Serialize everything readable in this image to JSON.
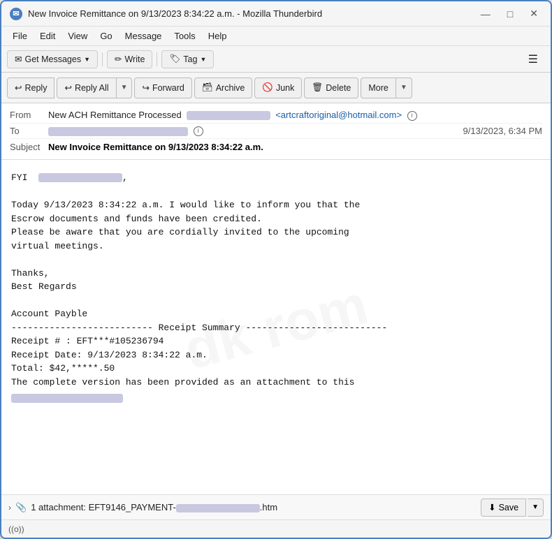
{
  "window": {
    "title": "New Invoice Remittance on 9/13/2023 8:34:22 a.m. - Mozilla Thunderbird",
    "icon": "T"
  },
  "titlebar": {
    "minimize": "—",
    "maximize": "□",
    "close": "✕"
  },
  "menubar": {
    "items": [
      "File",
      "Edit",
      "View",
      "Go",
      "Message",
      "Tools",
      "Help"
    ]
  },
  "toolbar": {
    "get_messages": "Get Messages",
    "write": "Write",
    "tag": "Tag",
    "hamburger": "☰"
  },
  "actionbar": {
    "reply": "Reply",
    "reply_all": "Reply All",
    "forward": "Forward",
    "archive": "Archive",
    "junk": "Junk",
    "delete": "Delete",
    "more": "More"
  },
  "email": {
    "from_label": "From",
    "from_name": "New ACH Remittance Processed",
    "from_email": "<artcraftoriginal@hotmail.com>",
    "to_label": "To",
    "date": "9/13/2023, 6:34 PM",
    "subject_label": "Subject",
    "subject": "New Invoice Remittance on 9/13/2023 8:34:22 a.m.",
    "body_greeting": "FYI",
    "body_lines": [
      "",
      "Today 9/13/2023 8:34:22 a.m. I would like to inform you that the",
      "Escrow documents and funds have been credited.",
      "Please be aware that you are cordially invited to the upcoming",
      "virtual meetings.",
      "",
      "Thanks,",
      "Best Regards",
      "",
      "Account Payble",
      "-------------------------- Receipt Summary --------------------------",
      "Receipt # : EFT***#105236794",
      "Receipt Date: 9/13/2023 8:34:22 a.m.",
      "Total: $42,*****.50",
      "The complete version has been  provided as an attachment to  this"
    ]
  },
  "attachment": {
    "label": "1 attachment: EFT9146_PAYMENT-",
    "extension": ".htm",
    "save": "Save"
  },
  "statusbar": {
    "signal": "((o))"
  }
}
